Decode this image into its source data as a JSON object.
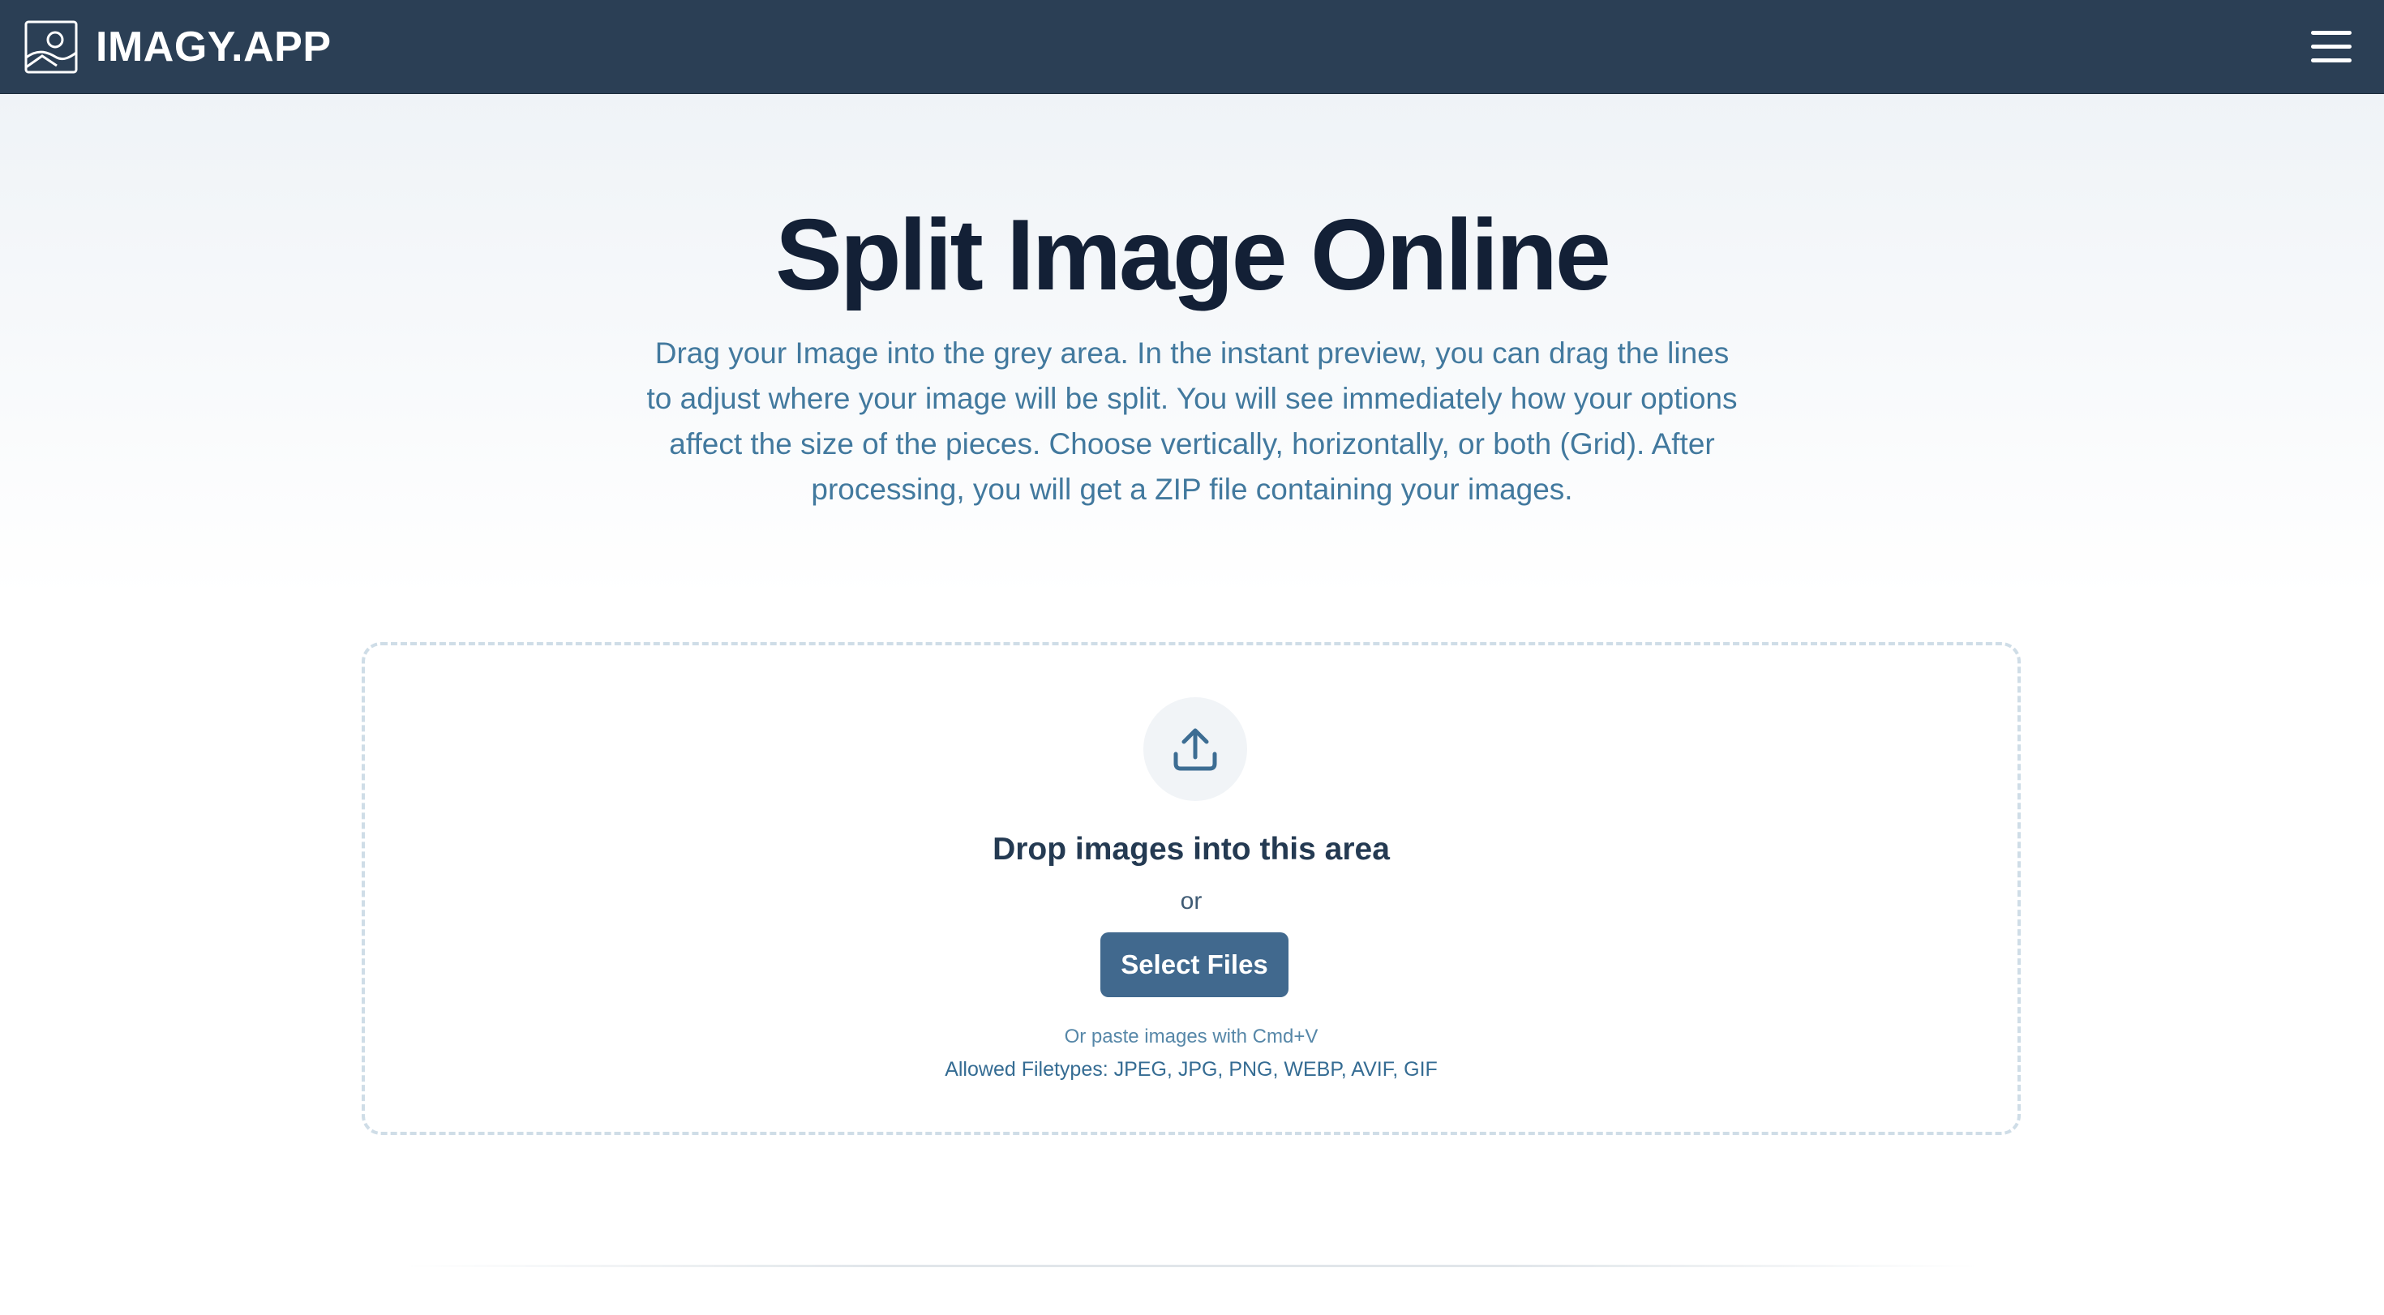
{
  "header": {
    "logo_text": "IMAGY.APP",
    "logo_icon": "image-portrait-icon",
    "menu_icon": "hamburger-menu-icon",
    "background_color": "#2b3f55"
  },
  "hero": {
    "title": "Split Image Online",
    "description": "Drag your Image into the grey area. In the instant preview, you can drag the lines to adjust where your image will be split. You will see immediately how your options affect the size of the pieces. Choose vertically, horizontally, or both (Grid). After processing, you will get a ZIP file containing your images."
  },
  "dropzone": {
    "icon": "upload-icon",
    "title": "Drop images into this area",
    "or_text": "or",
    "select_button_label": "Select Files",
    "paste_hint": "Or paste images with Cmd+V",
    "allowed_filetypes": "Allowed Filetypes: JPEG, JPG, PNG, WEBP, AVIF, GIF",
    "accent_color": "#41698e"
  }
}
